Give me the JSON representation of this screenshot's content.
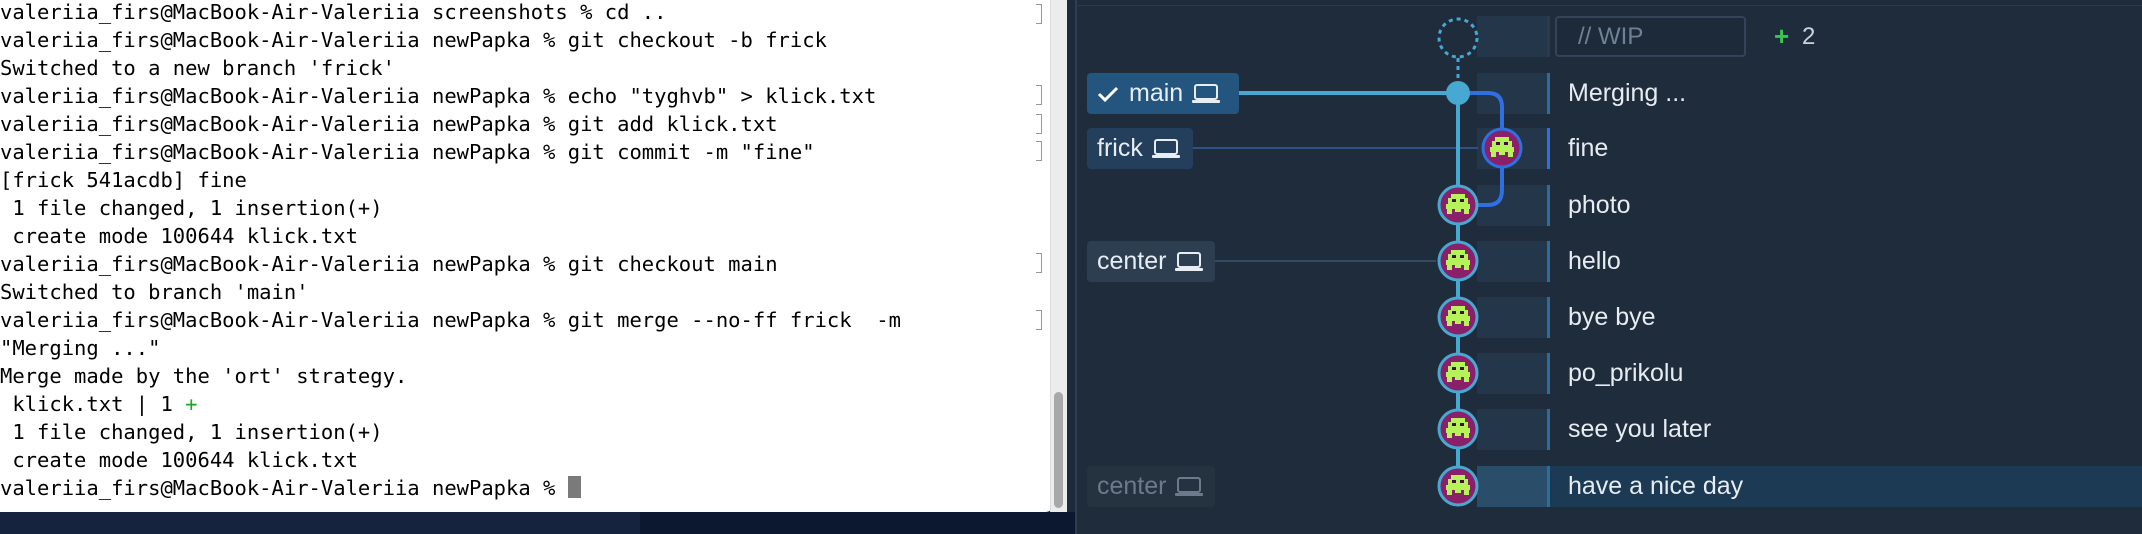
{
  "terminal": {
    "lines": [
      "valeriia_firs@MacBook-Air-Valeriia screenshots % cd ..",
      "valeriia_firs@MacBook-Air-Valeriia newPapka % git checkout -b frick",
      "Switched to a new branch 'frick'",
      "valeriia_firs@MacBook-Air-Valeriia newPapka % echo \"tyghvb\" > klick.txt",
      "valeriia_firs@MacBook-Air-Valeriia newPapka % git add klick.txt",
      "valeriia_firs@MacBook-Air-Valeriia newPapka % git commit -m \"fine\"",
      "[frick 541acdb] fine",
      " 1 file changed, 1 insertion(+)",
      " create mode 100644 klick.txt",
      "valeriia_firs@MacBook-Air-Valeriia newPapka % git checkout main",
      "Switched to branch 'main'",
      "valeriia_firs@MacBook-Air-Valeriia newPapka % git merge --no-ff frick  -m",
      "\"Merging ...\"",
      "Merge made by the 'ort' strategy.",
      " klick.txt | 1 ",
      " 1 file changed, 1 insertion(+)",
      " create mode 100644 klick.txt",
      "valeriia_firs@MacBook-Air-Valeriia newPapka % "
    ],
    "diff_plus": "+",
    "diff_plus_color": "#18a825"
  },
  "graph": {
    "wip": {
      "label": "// WIP",
      "plus": "+",
      "count": "2"
    },
    "branches": {
      "main": "main",
      "frick": "frick",
      "center": "center",
      "center_remote": "center"
    },
    "commits": [
      {
        "message": "Merging ..."
      },
      {
        "message": "fine"
      },
      {
        "message": "photo"
      },
      {
        "message": "hello"
      },
      {
        "message": "bye bye"
      },
      {
        "message": "po_prikolu"
      },
      {
        "message": "see you later"
      },
      {
        "message": "have a nice day"
      }
    ],
    "colors": {
      "main_lane": "#47a8d1",
      "frick_lane": "#2f6fe0",
      "avatar_bg": "#8a1f6a",
      "avatar_face": "#b6f25a"
    }
  }
}
